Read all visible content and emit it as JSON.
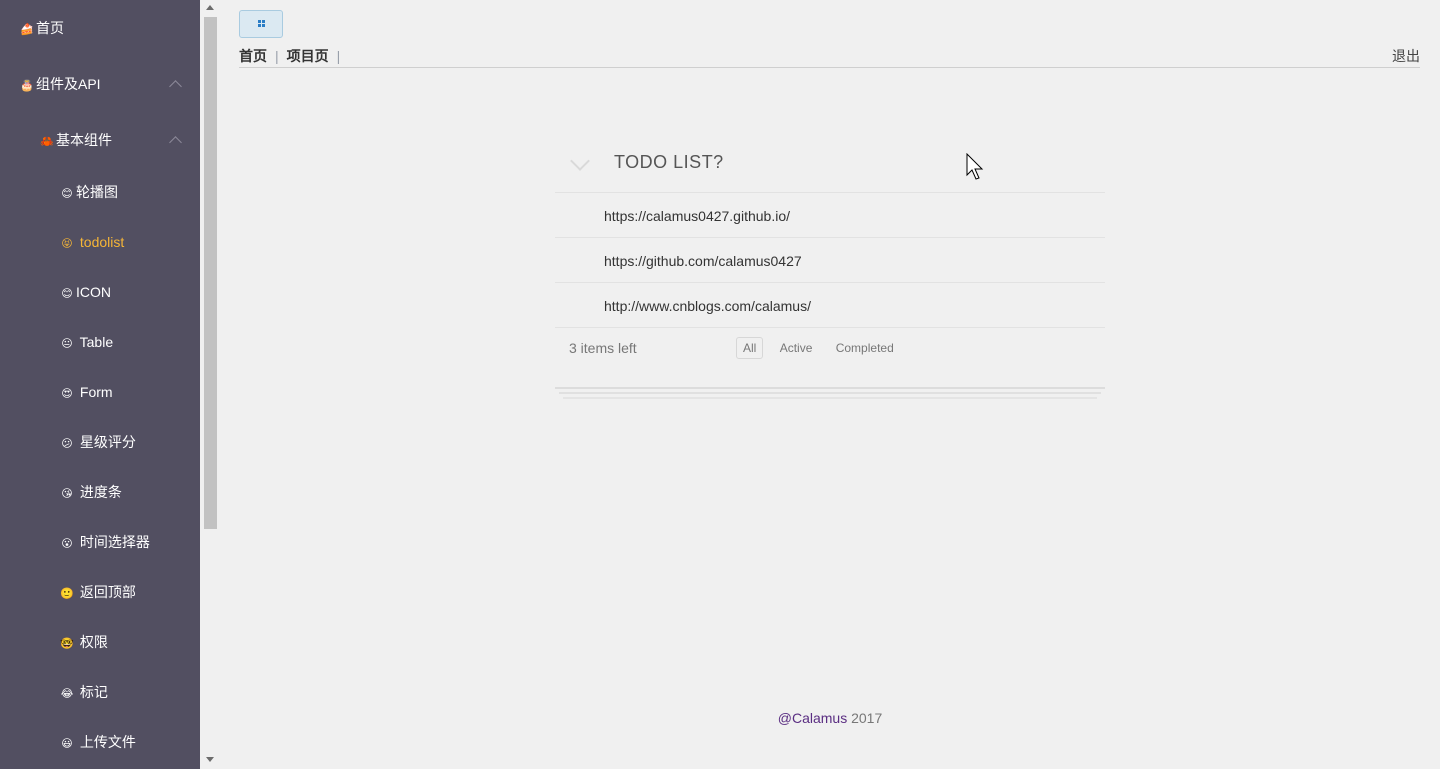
{
  "sidebar": {
    "items": [
      {
        "emoji": "🍰",
        "label": "首页"
      },
      {
        "emoji": "🎂",
        "label": "组件及API"
      },
      {
        "emoji": "🦀",
        "label": "基本组件"
      },
      {
        "emoji": "😊",
        "label": "轮播图"
      },
      {
        "emoji": "😝",
        "label": "todolist"
      },
      {
        "emoji": "😊",
        "label": "ICON"
      },
      {
        "emoji": "😐",
        "label": "Table"
      },
      {
        "emoji": "😍",
        "label": "Form"
      },
      {
        "emoji": "😕",
        "label": "星级评分"
      },
      {
        "emoji": "😘",
        "label": "进度条"
      },
      {
        "emoji": "😮",
        "label": "时间选择器"
      },
      {
        "emoji": "🙂",
        "label": "返回顶部"
      },
      {
        "emoji": "🤓",
        "label": "权限"
      },
      {
        "emoji": "😂",
        "label": "标记"
      },
      {
        "emoji": "😃",
        "label": "上传文件"
      }
    ],
    "active_index": 4
  },
  "header": {
    "breadcrumb": [
      "首页",
      "项目页"
    ],
    "logout": "退出"
  },
  "todo": {
    "title": "TODO LIST?",
    "items": [
      "https://calamus0427.github.io/",
      "https://github.com/calamus0427",
      "http://www.cnblogs.com/calamus/"
    ],
    "count_text": "3 items left",
    "filters": [
      "All",
      "Active",
      "Completed"
    ],
    "selected_filter": "All"
  },
  "footer": {
    "author": "@Calamus",
    "year": "2017"
  },
  "colors": {
    "sidebar_bg": "#524f61",
    "active": "#f5b537",
    "author": "#5a2d82"
  }
}
